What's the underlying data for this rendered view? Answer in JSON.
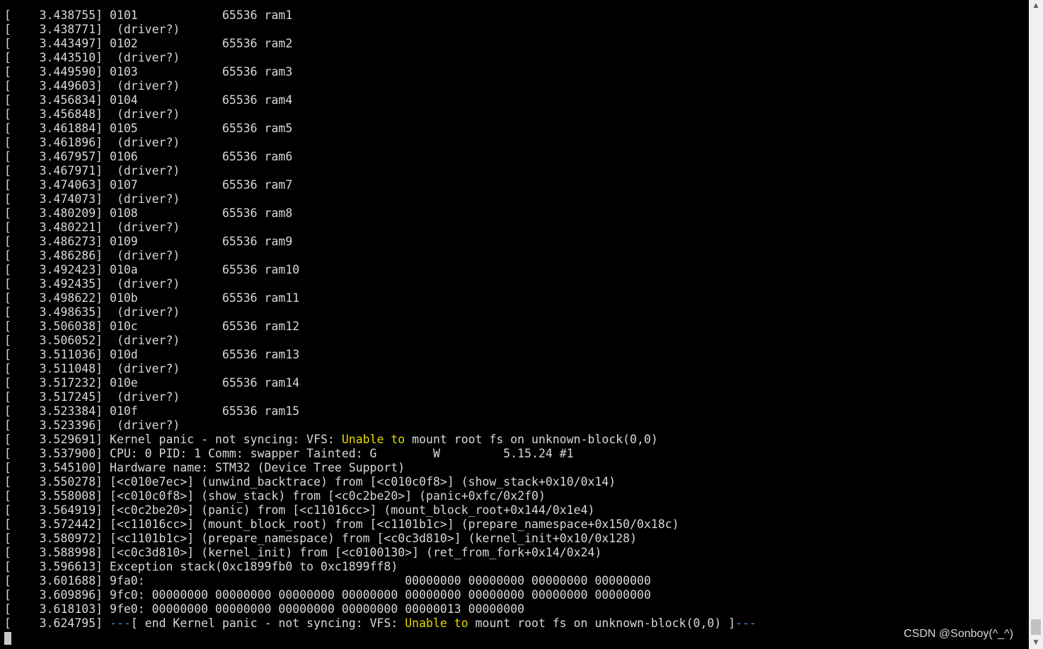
{
  "terminal": {
    "lines": [
      {
        "segments": [
          {
            "text": "[    3.438755] 0101            65536 ram1",
            "hl": ""
          }
        ]
      },
      {
        "segments": [
          {
            "text": "[    3.438771]  (driver?)",
            "hl": ""
          }
        ]
      },
      {
        "segments": [
          {
            "text": "[    3.443497] 0102            65536 ram2",
            "hl": ""
          }
        ]
      },
      {
        "segments": [
          {
            "text": "[    3.443510]  (driver?)",
            "hl": ""
          }
        ]
      },
      {
        "segments": [
          {
            "text": "[    3.449590] 0103            65536 ram3",
            "hl": ""
          }
        ]
      },
      {
        "segments": [
          {
            "text": "[    3.449603]  (driver?)",
            "hl": ""
          }
        ]
      },
      {
        "segments": [
          {
            "text": "[    3.456834] 0104            65536 ram4",
            "hl": ""
          }
        ]
      },
      {
        "segments": [
          {
            "text": "[    3.456848]  (driver?)",
            "hl": ""
          }
        ]
      },
      {
        "segments": [
          {
            "text": "[    3.461884] 0105            65536 ram5",
            "hl": ""
          }
        ]
      },
      {
        "segments": [
          {
            "text": "[    3.461896]  (driver?)",
            "hl": ""
          }
        ]
      },
      {
        "segments": [
          {
            "text": "[    3.467957] 0106            65536 ram6",
            "hl": ""
          }
        ]
      },
      {
        "segments": [
          {
            "text": "[    3.467971]  (driver?)",
            "hl": ""
          }
        ]
      },
      {
        "segments": [
          {
            "text": "[    3.474063] 0107            65536 ram7",
            "hl": ""
          }
        ]
      },
      {
        "segments": [
          {
            "text": "[    3.474073]  (driver?)",
            "hl": ""
          }
        ]
      },
      {
        "segments": [
          {
            "text": "[    3.480209] 0108            65536 ram8",
            "hl": ""
          }
        ]
      },
      {
        "segments": [
          {
            "text": "[    3.480221]  (driver?)",
            "hl": ""
          }
        ]
      },
      {
        "segments": [
          {
            "text": "[    3.486273] 0109            65536 ram9",
            "hl": ""
          }
        ]
      },
      {
        "segments": [
          {
            "text": "[    3.486286]  (driver?)",
            "hl": ""
          }
        ]
      },
      {
        "segments": [
          {
            "text": "[    3.492423] 010a            65536 ram10",
            "hl": ""
          }
        ]
      },
      {
        "segments": [
          {
            "text": "[    3.492435]  (driver?)",
            "hl": ""
          }
        ]
      },
      {
        "segments": [
          {
            "text": "[    3.498622] 010b            65536 ram11",
            "hl": ""
          }
        ]
      },
      {
        "segments": [
          {
            "text": "[    3.498635]  (driver?)",
            "hl": ""
          }
        ]
      },
      {
        "segments": [
          {
            "text": "[    3.506038] 010c            65536 ram12",
            "hl": ""
          }
        ]
      },
      {
        "segments": [
          {
            "text": "[    3.506052]  (driver?)",
            "hl": ""
          }
        ]
      },
      {
        "segments": [
          {
            "text": "[    3.511036] 010d            65536 ram13",
            "hl": ""
          }
        ]
      },
      {
        "segments": [
          {
            "text": "[    3.511048]  (driver?)",
            "hl": ""
          }
        ]
      },
      {
        "segments": [
          {
            "text": "[    3.517232] 010e            65536 ram14",
            "hl": ""
          }
        ]
      },
      {
        "segments": [
          {
            "text": "[    3.517245]  (driver?)",
            "hl": ""
          }
        ]
      },
      {
        "segments": [
          {
            "text": "[    3.523384] 010f            65536 ram15",
            "hl": ""
          }
        ]
      },
      {
        "segments": [
          {
            "text": "[    3.523396]  (driver?)",
            "hl": ""
          }
        ]
      },
      {
        "segments": [
          {
            "text": "[    3.529691] Kernel panic - not syncing: VFS: ",
            "hl": ""
          },
          {
            "text": "Unable to",
            "hl": "yellow"
          },
          {
            "text": " mount root fs on unknown-block(0,0)",
            "hl": ""
          }
        ]
      },
      {
        "segments": [
          {
            "text": "[    3.537900] CPU: 0 PID: 1 Comm: swapper Tainted: G        W         5.15.24 #1",
            "hl": ""
          }
        ]
      },
      {
        "segments": [
          {
            "text": "[    3.545100] Hardware name: STM32 (Device Tree Support)",
            "hl": ""
          }
        ]
      },
      {
        "segments": [
          {
            "text": "[    3.550278] [<c010e7ec>] (unwind_backtrace) from [<c010c0f8>] (show_stack+0x10/0x14)",
            "hl": ""
          }
        ]
      },
      {
        "segments": [
          {
            "text": "[    3.558008] [<c010c0f8>] (show_stack) from [<c0c2be20>] (panic+0xfc/0x2f0)",
            "hl": ""
          }
        ]
      },
      {
        "segments": [
          {
            "text": "[    3.564919] [<c0c2be20>] (panic) from [<c11016cc>] (mount_block_root+0x144/0x1e4)",
            "hl": ""
          }
        ]
      },
      {
        "segments": [
          {
            "text": "[    3.572442] [<c11016cc>] (mount_block_root) from [<c1101b1c>] (prepare_namespace+0x150/0x18c)",
            "hl": ""
          }
        ]
      },
      {
        "segments": [
          {
            "text": "[    3.580972] [<c1101b1c>] (prepare_namespace) from [<c0c3d810>] (kernel_init+0x10/0x128)",
            "hl": ""
          }
        ]
      },
      {
        "segments": [
          {
            "text": "[    3.588998] [<c0c3d810>] (kernel_init) from [<c0100130>] (ret_from_fork+0x14/0x24)",
            "hl": ""
          }
        ]
      },
      {
        "segments": [
          {
            "text": "[    3.596613] Exception stack(0xc1899fb0 to 0xc1899ff8)",
            "hl": ""
          }
        ]
      },
      {
        "segments": [
          {
            "text": "[    3.601688] 9fa0:                                     00000000 00000000 00000000 00000000",
            "hl": ""
          }
        ]
      },
      {
        "segments": [
          {
            "text": "[    3.609896] 9fc0: 00000000 00000000 00000000 00000000 00000000 00000000 00000000 00000000",
            "hl": ""
          }
        ]
      },
      {
        "segments": [
          {
            "text": "[    3.618103] 9fe0: 00000000 00000000 00000000 00000000 00000013 00000000",
            "hl": ""
          }
        ]
      },
      {
        "segments": [
          {
            "text": "[    3.624795] ",
            "hl": ""
          },
          {
            "text": "---",
            "hl": "blue"
          },
          {
            "text": "[ end Kernel panic - not syncing: VFS: ",
            "hl": ""
          },
          {
            "text": "Unable to",
            "hl": "yellow"
          },
          {
            "text": " mount root fs on unknown-block(0,0) ]",
            "hl": ""
          },
          {
            "text": "---",
            "hl": "blue"
          }
        ]
      }
    ]
  },
  "watermark": "CSDN @Sonboy(^_^)",
  "scrollbar": {
    "up_glyph": "▲",
    "down_glyph": "▼"
  },
  "colors": {
    "background": "#000000",
    "text": "#d8d8d8",
    "highlight_yellow": "#e6d800",
    "highlight_blue": "#4a8bd6"
  }
}
